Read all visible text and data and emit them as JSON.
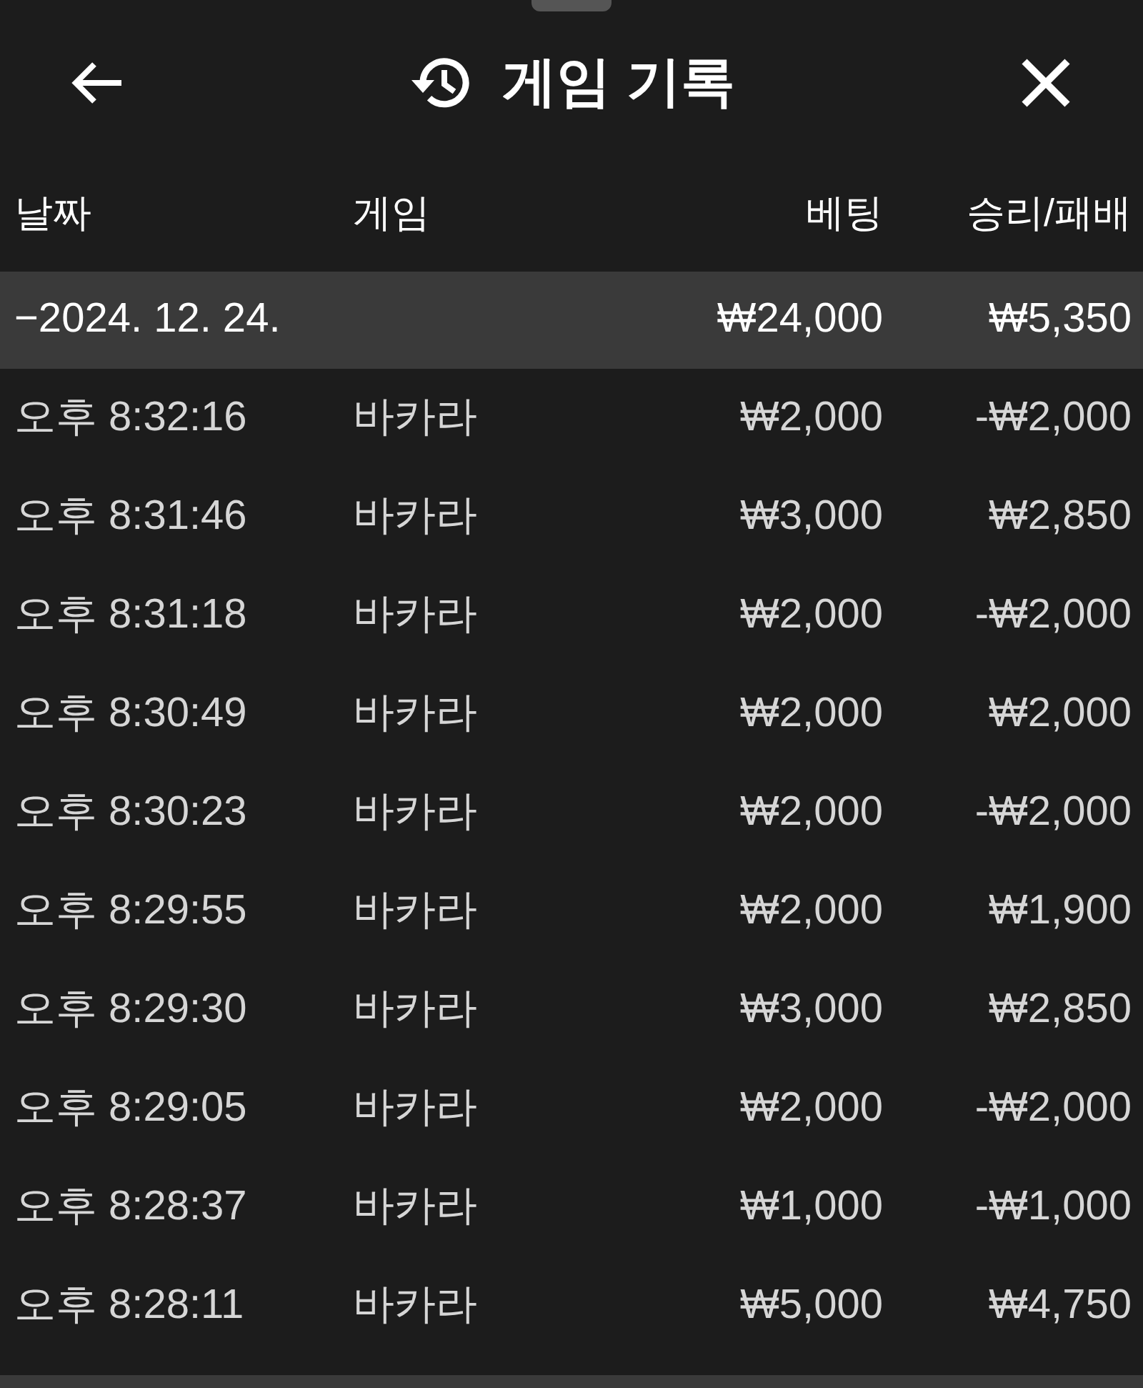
{
  "header": {
    "title": "게임 기록"
  },
  "columns": [
    "날짜",
    "게임",
    "베팅",
    "승리/패배"
  ],
  "date_group": {
    "date": "−2024. 12. 24.",
    "bet": "₩24,000",
    "result": "₩5,350"
  },
  "rows": [
    {
      "time": "오후 8:32:16",
      "game": "바카라",
      "bet": "₩2,000",
      "result": "-₩2,000"
    },
    {
      "time": "오후 8:31:46",
      "game": "바카라",
      "bet": "₩3,000",
      "result": "₩2,850"
    },
    {
      "time": "오후 8:31:18",
      "game": "바카라",
      "bet": "₩2,000",
      "result": "-₩2,000"
    },
    {
      "time": "오후 8:30:49",
      "game": "바카라",
      "bet": "₩2,000",
      "result": "₩2,000"
    },
    {
      "time": "오후 8:30:23",
      "game": "바카라",
      "bet": "₩2,000",
      "result": "-₩2,000"
    },
    {
      "time": "오후 8:29:55",
      "game": "바카라",
      "bet": "₩2,000",
      "result": "₩1,900"
    },
    {
      "time": "오후 8:29:30",
      "game": "바카라",
      "bet": "₩3,000",
      "result": "₩2,850"
    },
    {
      "time": "오후 8:29:05",
      "game": "바카라",
      "bet": "₩2,000",
      "result": "-₩2,000"
    },
    {
      "time": "오후 8:28:37",
      "game": "바카라",
      "bet": "₩1,000",
      "result": "-₩1,000"
    },
    {
      "time": "오후 8:28:11",
      "game": "바카라",
      "bet": "₩5,000",
      "result": "₩4,750"
    }
  ]
}
